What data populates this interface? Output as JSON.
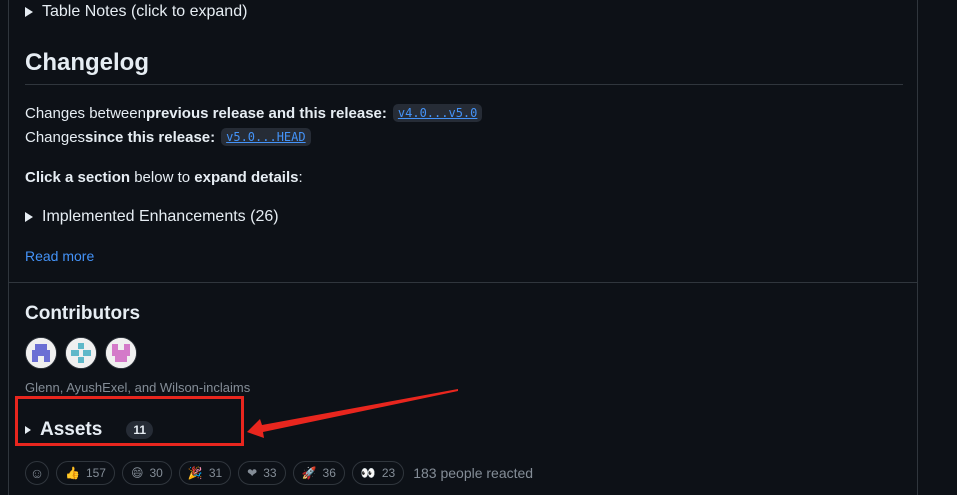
{
  "table_notes": {
    "label": "Table Notes (click to expand)"
  },
  "changelog": {
    "title": "Changelog",
    "line1": {
      "prefix": "Changes between ",
      "bold": "previous release and this release:",
      "link": "v4.0...v5.0"
    },
    "line2": {
      "prefix": "Changes ",
      "bold": "since this release:",
      "link": "v5.0...HEAD"
    },
    "line3": {
      "bold1": "Click a section",
      "mid": " below to ",
      "bold2": "expand details",
      "suffix": ":"
    },
    "section": "Implemented Enhancements (26)",
    "read_more": "Read more"
  },
  "contributors": {
    "title": "Contributors",
    "names": "Glenn, AyushExel, and Wilson-inclaims",
    "avatar_colors": [
      "#6b6fd4",
      "#5fb8c9",
      "#d47ac9"
    ]
  },
  "assets": {
    "label": "Assets",
    "count": "11"
  },
  "annotation": {
    "color": "#e8261e"
  },
  "reactions": {
    "add_icon": "smiley-add-icon",
    "items": [
      {
        "icon": "thumbs-up-icon",
        "glyph": "👍",
        "count": "157"
      },
      {
        "icon": "laugh-icon",
        "glyph": "😄",
        "count": "30"
      },
      {
        "icon": "tada-icon",
        "glyph": "🎉",
        "count": "31"
      },
      {
        "icon": "heart-icon",
        "glyph": "❤",
        "count": "33"
      },
      {
        "icon": "rocket-icon",
        "glyph": "🚀",
        "count": "36"
      },
      {
        "icon": "eyes-icon",
        "glyph": "👀",
        "count": "23"
      }
    ],
    "summary": "183 people reacted"
  }
}
